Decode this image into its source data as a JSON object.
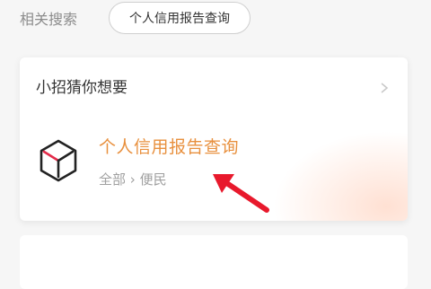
{
  "related": {
    "label": "相关搜索",
    "chip": "个人信用报告查询"
  },
  "card": {
    "header": "小招猜你想要",
    "result": {
      "title": "个人信用报告查询",
      "category": "全部",
      "separator": "›",
      "subcategory": "便民",
      "icon": "cube-logo-icon"
    }
  },
  "colors": {
    "accent": "#e8903e",
    "annotation": "#e8192c"
  }
}
